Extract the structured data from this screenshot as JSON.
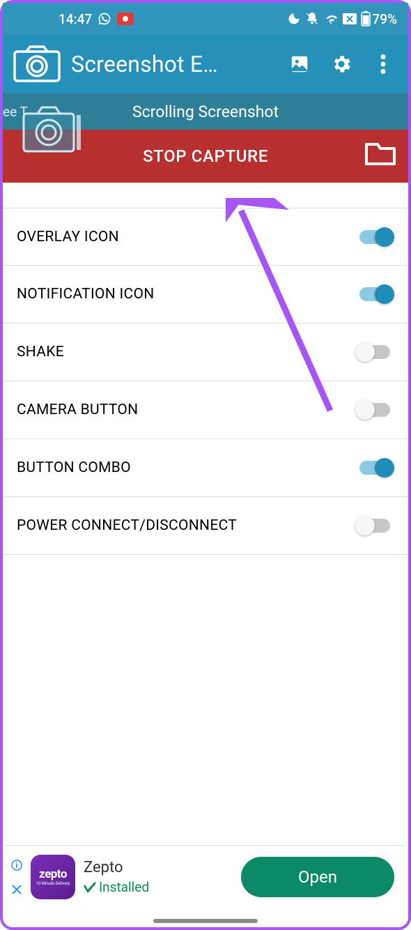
{
  "status": {
    "time": "14:47",
    "battery": "79%"
  },
  "appbar": {
    "title": "Screenshot E…"
  },
  "banner": {
    "left_text": "ee T",
    "title": "Scrolling Screenshot"
  },
  "capture": {
    "stop_label": "STOP CAPTURE"
  },
  "settings": [
    {
      "label": "OVERLAY ICON",
      "on": true
    },
    {
      "label": "NOTIFICATION ICON",
      "on": true
    },
    {
      "label": "SHAKE",
      "on": false
    },
    {
      "label": "CAMERA BUTTON",
      "on": false
    },
    {
      "label": "BUTTON COMBO",
      "on": true
    },
    {
      "label": "POWER CONNECT/DISCONNECT",
      "on": false
    }
  ],
  "ad": {
    "logo_text": "zepto",
    "logo_sub": "10 Minute Delivery",
    "title": "Zepto",
    "status": "Installed",
    "cta": "Open"
  }
}
